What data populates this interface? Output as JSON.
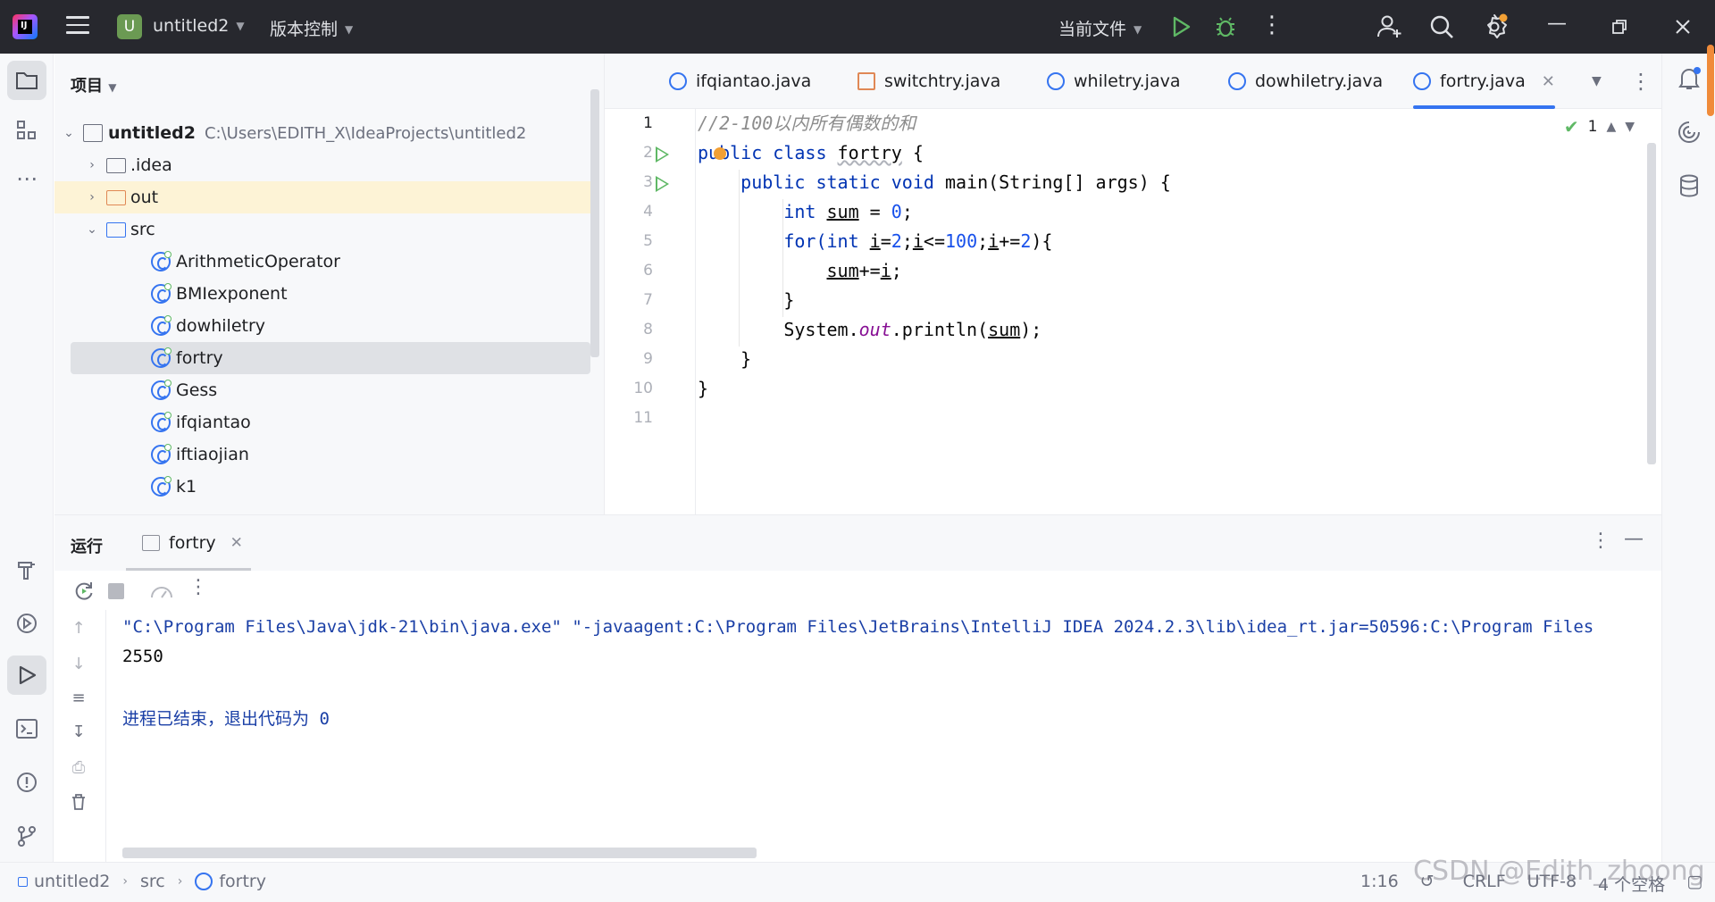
{
  "titlebar": {
    "app_icon": "intellij-idea-icon",
    "project_badge": "U",
    "project_name": "untitled2",
    "vcs_menu": "版本控制",
    "run_config": "当前文件"
  },
  "project_panel": {
    "title": "项目",
    "tree": [
      {
        "label": "untitled2",
        "path": "C:\\Users\\EDITH_X\\IdeaProjects\\untitled2",
        "type": "module",
        "expanded": true
      },
      {
        "label": ".idea",
        "type": "folder",
        "expanded": false
      },
      {
        "label": "out",
        "type": "folder-excluded",
        "expanded": false
      },
      {
        "label": "src",
        "type": "folder-source",
        "expanded": true
      },
      {
        "label": "ArithmeticOperator",
        "type": "class"
      },
      {
        "label": "BMIexponent",
        "type": "class"
      },
      {
        "label": "dowhiletry",
        "type": "class"
      },
      {
        "label": "fortry",
        "type": "class",
        "selected": true
      },
      {
        "label": "Gess",
        "type": "class"
      },
      {
        "label": "ifqiantao",
        "type": "class"
      },
      {
        "label": "iftiaojian",
        "type": "class"
      },
      {
        "label": "k1",
        "type": "class"
      }
    ]
  },
  "editor": {
    "tabs": [
      {
        "label": "ifqiantao.java",
        "icon": "class-icon"
      },
      {
        "label": "switchtry.java",
        "icon": "java-file-icon"
      },
      {
        "label": "whiletry.java",
        "icon": "class-icon"
      },
      {
        "label": "dowhiletry.java",
        "icon": "class-icon"
      },
      {
        "label": "fortry.java",
        "icon": "class-icon",
        "active": true
      }
    ],
    "inspection_count": "1",
    "line_numbers": [
      "1",
      "2",
      "3",
      "4",
      "5",
      "6",
      "7",
      "8",
      "9",
      "10",
      "11"
    ],
    "code": {
      "l1": "//2-100以内所有偶数的和",
      "l2_kw": "public class",
      "l2_name": "fortry",
      "l2_end": "{",
      "l3_kw": "public static void",
      "l3_rest": "main(String[] args) {",
      "l4_kw": "int",
      "l4_var": "sum",
      "l4_eq": "=",
      "l4_num": "0",
      "l4_end": ";",
      "l5_for": "for(",
      "l5_int": "int",
      "l5_i1": "i",
      "l5_eq": "=",
      "l5_2a": "2",
      "l5_semi1": ";",
      "l5_i2": "i",
      "l5_le": "<=",
      "l5_100": "100",
      "l5_semi2": ";",
      "l5_i3": "i",
      "l5_pe": "+=",
      "l5_2b": "2",
      "l5_end": "){",
      "l6_sum": "sum",
      "l6_op": "+=",
      "l6_i": "i",
      "l6_end": ";",
      "l7": "}",
      "l8_a": "System.",
      "l8_out": "out",
      "l8_b": ".println(",
      "l8_sum": "sum",
      "l8_c": ");",
      "l9": "}",
      "l10": "}"
    }
  },
  "run_panel": {
    "title": "运行",
    "tab_label": "fortry",
    "console": [
      "\"C:\\Program Files\\Java\\jdk-21\\bin\\java.exe\" \"-javaagent:C:\\Program Files\\JetBrains\\IntelliJ IDEA 2024.2.3\\lib\\idea_rt.jar=50596:C:\\Program Files",
      "2550",
      "",
      "进程已结束，退出代码为 0"
    ]
  },
  "statusbar": {
    "crumbs": [
      "untitled2",
      "src",
      "fortry"
    ],
    "position": "1:16",
    "line_sep": "CRLF",
    "encoding": "UTF-8",
    "indent": "4 个空格"
  },
  "watermark": "CSDN @Edith_zhoong",
  "colors": {
    "accent": "#3574f0",
    "run_green": "#5fb865",
    "keyword": "#0033b3",
    "number": "#1750eb",
    "comment": "#8c8c8c",
    "field": "#871094",
    "titlebar_bg": "#27282e"
  }
}
